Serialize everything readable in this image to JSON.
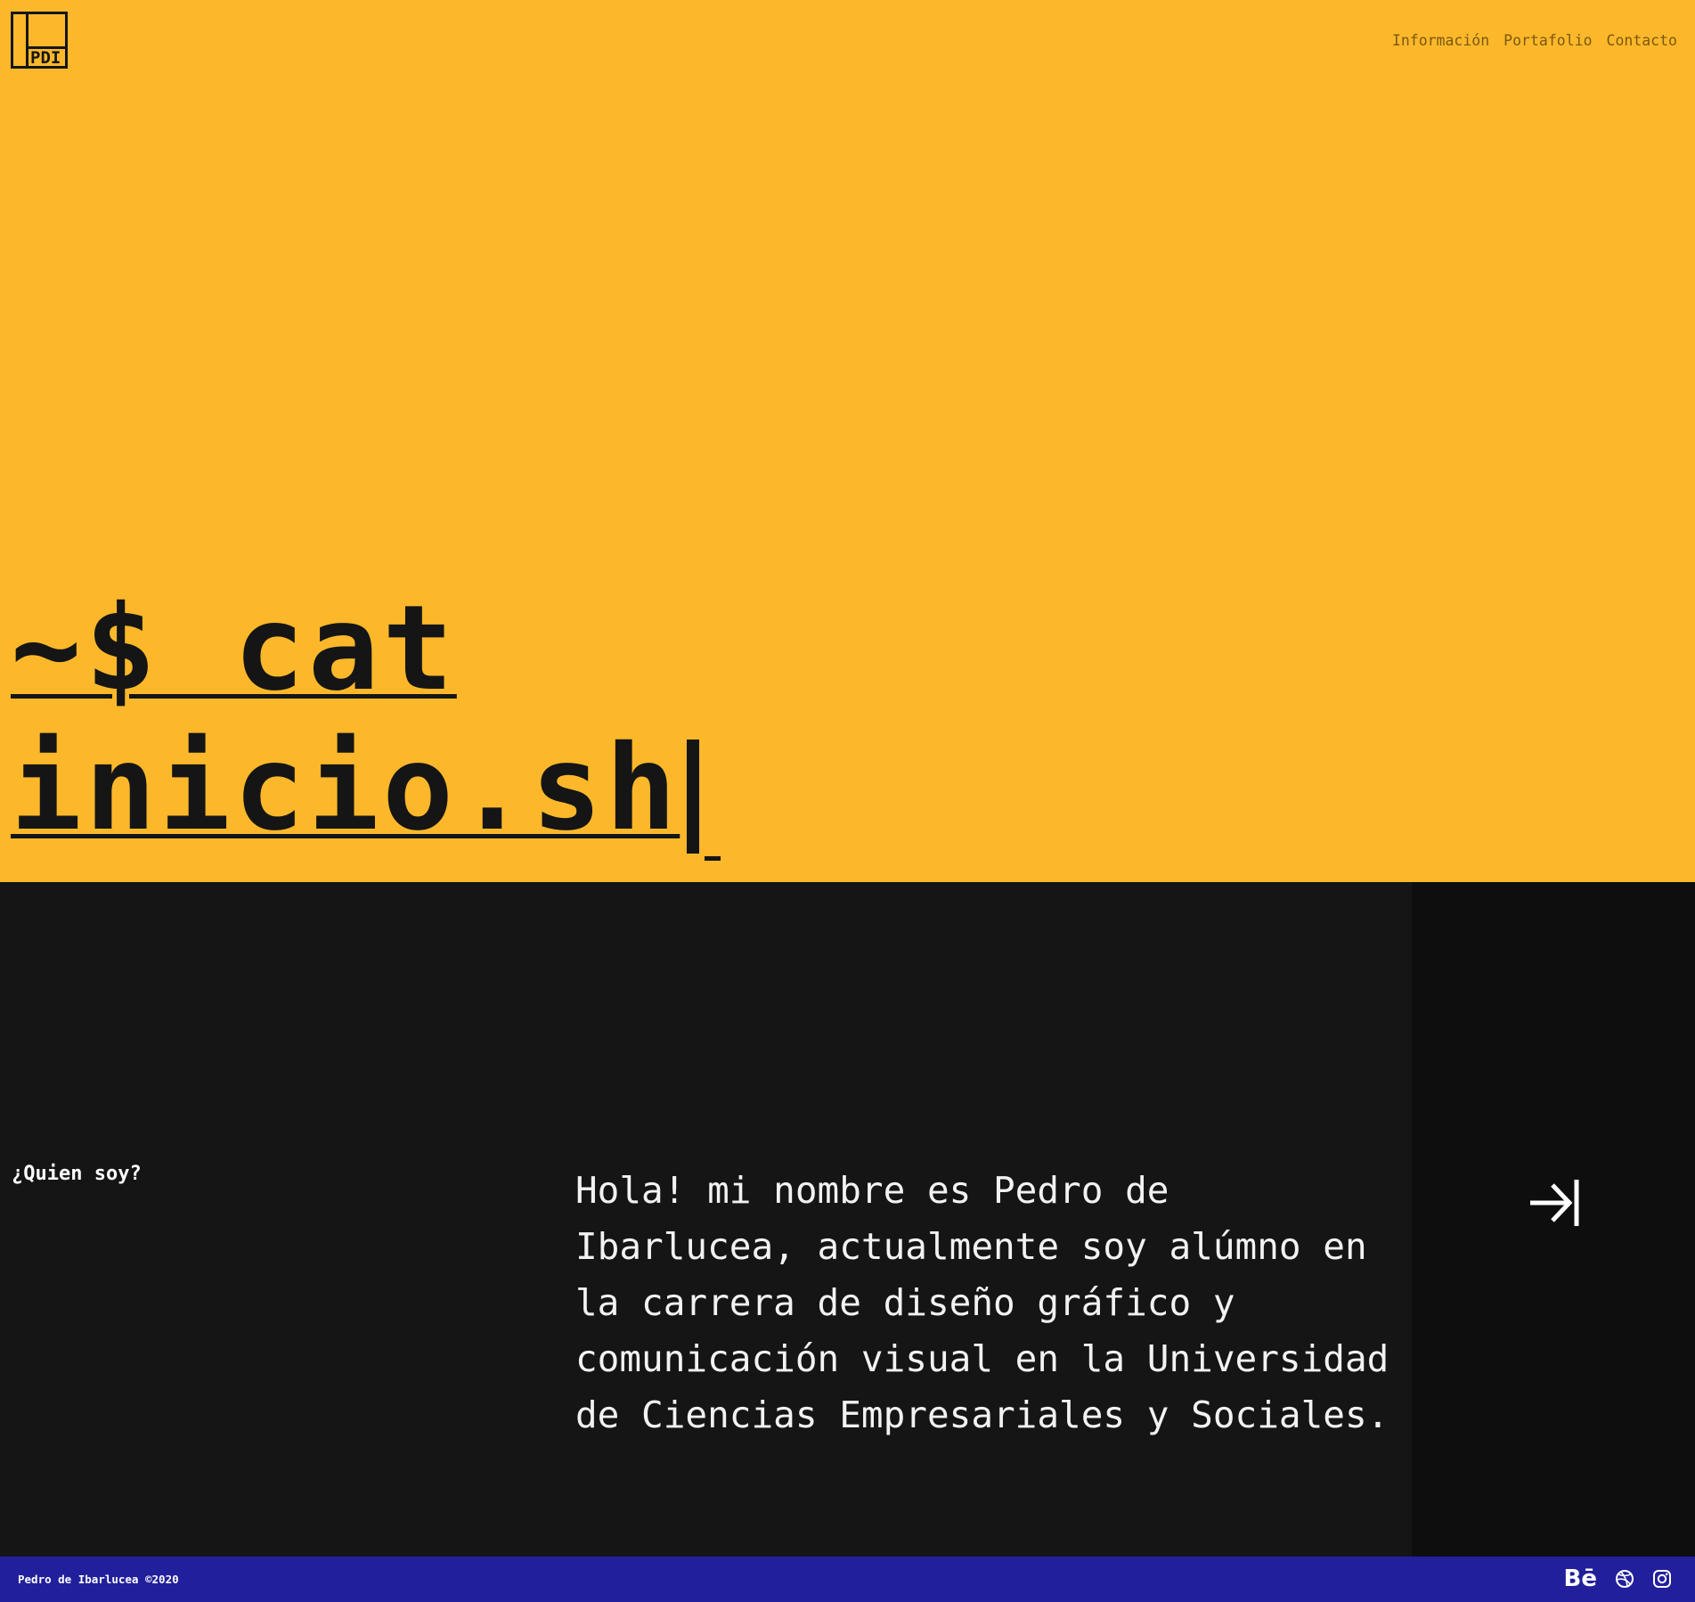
{
  "header": {
    "logo_text": "PDI",
    "nav": [
      {
        "label": "Información"
      },
      {
        "label": "Portafolio"
      },
      {
        "label": "Contacto"
      }
    ]
  },
  "hero": {
    "line1": "~$ cat",
    "line2": "inicio.sh",
    "background_color": "#fcb82a"
  },
  "about": {
    "label": "¿Quien soy?",
    "text": "Hola! mi nombre es Pedro de Ibarlucea, actualmente soy alúmno en la carrera de diseño gráfico y comunicación visual en la Universidad de Ciencias Empresariales y Sociales.",
    "next_icon": "arrow-right-to-bar-icon"
  },
  "footer": {
    "copyright": "Pedro de Ibarlucea ©2020",
    "background_color": "#221f9c",
    "social": [
      "behance-icon",
      "dribbble-icon",
      "instagram-icon"
    ]
  }
}
